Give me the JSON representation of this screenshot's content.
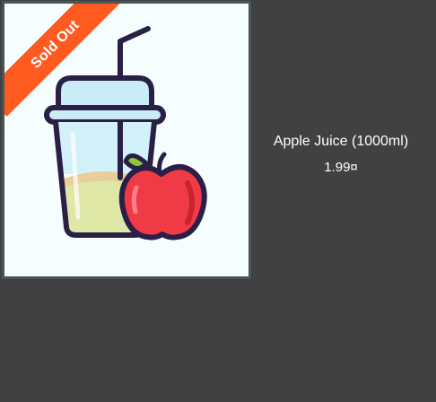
{
  "product": {
    "name": "Apple Juice (1000ml)",
    "price": "1.99¤",
    "badge": "Sold Out",
    "image_icon": "juice-cup-with-apple-icon"
  },
  "colors": {
    "page_background": "#414141",
    "card_border": "#4a5558",
    "image_background": "#f5fdff",
    "badge_background": "#ff5a1f",
    "badge_text": "#ffffff",
    "info_text": "#ffffff"
  }
}
